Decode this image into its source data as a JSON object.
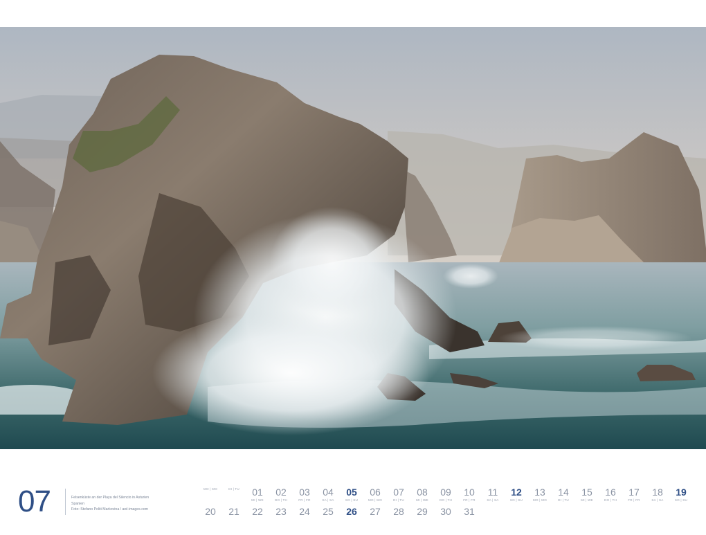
{
  "month": {
    "number": "07"
  },
  "caption": {
    "line1": "Felsenküste an der Playa del Silencio in Asturien",
    "line2": "Spanien",
    "line3": "Foto: Stefano Politi Markovina / awl-images.com"
  },
  "days_row1": [
    {
      "n": "",
      "w": "MO | MO"
    },
    {
      "n": "",
      "w": "DI | TU"
    },
    {
      "n": "01",
      "w": "MI | WE"
    },
    {
      "n": "02",
      "w": "DO | TH"
    },
    {
      "n": "03",
      "w": "FR | FR"
    },
    {
      "n": "04",
      "w": "SA | SA"
    },
    {
      "n": "05",
      "w": "SO | SU"
    },
    {
      "n": "06",
      "w": "MO | MO"
    },
    {
      "n": "07",
      "w": "DI | TU"
    },
    {
      "n": "08",
      "w": "MI | WE"
    },
    {
      "n": "09",
      "w": "DO | TH"
    },
    {
      "n": "10",
      "w": "FR | FR"
    },
    {
      "n": "11",
      "w": "SA | SA"
    },
    {
      "n": "12",
      "w": "SO | SU"
    },
    {
      "n": "13",
      "w": "MO | MO"
    },
    {
      "n": "14",
      "w": "DI | TU"
    },
    {
      "n": "15",
      "w": "MI | WE"
    },
    {
      "n": "16",
      "w": "DO | TH"
    },
    {
      "n": "17",
      "w": "FR | FR"
    },
    {
      "n": "18",
      "w": "SA | SA"
    },
    {
      "n": "19",
      "w": "SO | SU"
    }
  ],
  "days_row2": [
    "20",
    "21",
    "22",
    "23",
    "24",
    "25",
    "26",
    "27",
    "28",
    "29",
    "30",
    "31"
  ],
  "colors": {
    "accent": "#2f4f86",
    "muted": "#8a93a3"
  }
}
